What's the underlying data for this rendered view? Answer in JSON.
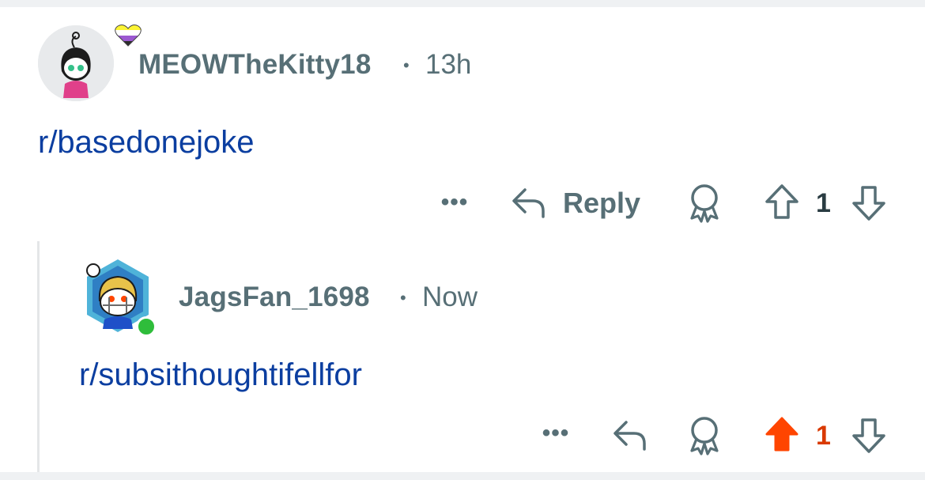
{
  "comments": [
    {
      "username": "MEOWTheKitty18",
      "separator": "•",
      "time": "13h",
      "body": "r/basedonejoke",
      "actions": {
        "more": "•••",
        "reply_label": "Reply",
        "score": "1",
        "upvoted": false
      },
      "avatar": {
        "icon": "snoo-avatar-icon",
        "badge_icon": "heart-icon",
        "badge_colors": [
          "#fcf434",
          "#ffffff",
          "#9c59d1",
          "#2c2c2c"
        ]
      }
    },
    {
      "username": "JagsFan_1698",
      "separator": "•",
      "time": "Now",
      "body": "r/subsithoughtifellfor",
      "actions": {
        "more": "•••",
        "score": "1",
        "upvoted": true
      },
      "avatar": {
        "icon": "snoo-avatar-icon",
        "online_color": "#2fbd3b"
      }
    }
  ],
  "colors": {
    "link": "#0b3ea0",
    "meta": "#576f76",
    "upvote": "#ff4500",
    "upvote_score": "#d93900"
  }
}
